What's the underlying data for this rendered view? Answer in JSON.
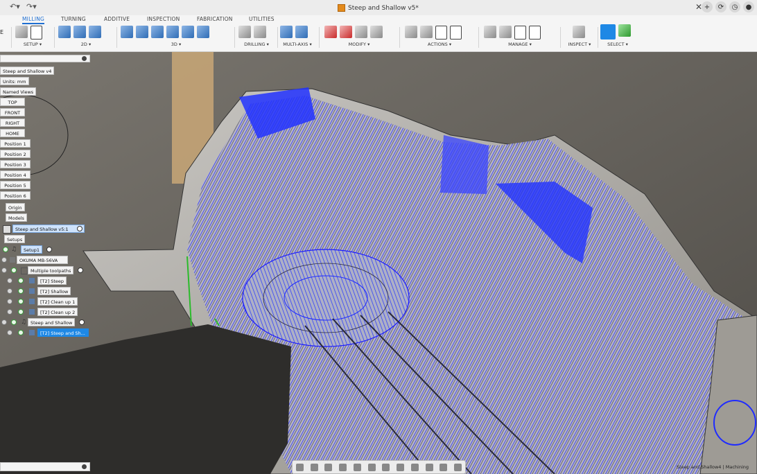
{
  "title_bar": {
    "document_title": "Steep and Shallow v5*",
    "undo_icon": "undo-icon",
    "redo_icon": "redo-icon",
    "close_tab_icon": "close-icon",
    "new_tab_icon": "plus-icon"
  },
  "ribbon": {
    "tabs": [
      "MILLING",
      "TURNING",
      "ADDITIVE",
      "INSPECTION",
      "FABRICATION",
      "UTILITIES"
    ],
    "active_tab": "MILLING",
    "groups": [
      {
        "label": "SETUP ▾"
      },
      {
        "label": "2D ▾"
      },
      {
        "label": "3D ▾"
      },
      {
        "label": "DRILLING ▾"
      },
      {
        "label": "MULTI-AXIS ▾"
      },
      {
        "label": "MODIFY ▾"
      },
      {
        "label": "ACTIONS ▾"
      },
      {
        "label": "MANAGE ▾"
      },
      {
        "label": "INSPECT ▾"
      },
      {
        "label": "SELECT ▾"
      }
    ],
    "workspace_partial": "E"
  },
  "browser": {
    "root": "Steep and Shallow v4",
    "units": "Units: mm",
    "named_views": "Named Views",
    "views": [
      "TOP",
      "FRONT",
      "RIGHT",
      "HOME",
      "Position 1",
      "Position 2",
      "Position 3",
      "Position 4",
      "Position 5",
      "Position 6"
    ],
    "origin": "Origin",
    "models": "Models",
    "component": "Steep and Shallow v5:1",
    "setups": "Setups",
    "setup1": "Setup1",
    "machine": "OKUMA MB-56VA",
    "folder": "Multiple toolpaths",
    "ops": [
      "[T2] Steep",
      "[T2] Shallow",
      "[T2] Clean up 1",
      "[T2] Clean up 2"
    ],
    "combined": "Steep and Shallow",
    "selected_op": "[T2] Steep and Sh..."
  },
  "status_text": "Steep and Shallow4 | Machining",
  "colors": {
    "toolpath": "#1f2bff",
    "accent": "#1e88e5",
    "part": "#b9b6b0",
    "stock": "#cfa86e"
  }
}
